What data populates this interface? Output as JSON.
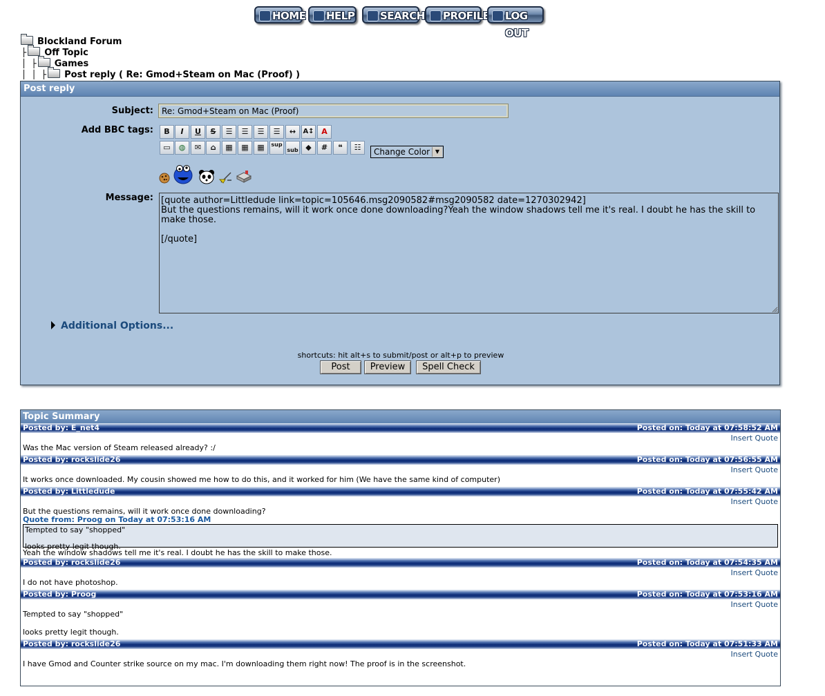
{
  "nav": {
    "home": "HOME",
    "help": "HELP",
    "search": "SEARCH",
    "profile": "PROFILE",
    "logout": "LOG OUT"
  },
  "breadcrumb": {
    "level0": "Blockland Forum",
    "level1": "Off Topic",
    "level2": "Games",
    "level3": "Post reply ( Re: Gmod+Steam on Mac (Proof) )"
  },
  "reply": {
    "header": "Post reply",
    "subject_label": "Subject:",
    "subject_value": "Re: Gmod+Steam on Mac (Proof)",
    "bbc_label": "Add BBC tags:",
    "color_select": "Change Color",
    "message_label": "Message:",
    "message_value": "[quote author=Littledude link=topic=105646.msg2090582#msg2090582 date=1270302942]\nBut the questions remains, will it work once done downloading?Yeah the window shadows tell me it's real. I doubt he has the skill to make those.\n\n[/quote]",
    "additional_options": "Additional Options...",
    "shortcuts": "shortcuts: hit alt+s to submit/post or alt+p to preview",
    "post_button": "Post",
    "preview_button": "Preview",
    "spellcheck_button": "Spell Check",
    "toolbar_row1": [
      "B",
      "I",
      "U",
      "S",
      "≡",
      "≡",
      "≡",
      "≡",
      "↔",
      "A↕",
      "A"
    ],
    "toolbar_row2_text": {
      "sup": "sup",
      "sub": "sub"
    }
  },
  "summary": {
    "header": "Topic Summary",
    "insert_quote": "Insert Quote",
    "posts": [
      {
        "by": "Posted by: E_net4",
        "on": "Posted on: Today at 07:58:52 AM",
        "text": "Was the Mac version of Steam released already? :/"
      },
      {
        "by": "Posted by: rockslide26",
        "on": "Posted on: Today at 07:56:55 AM",
        "text": "It works once downloaded. My cousin showed me how to do this, and it worked for him (We have the same kind of computer)"
      },
      {
        "by": "Posted by: Littledude",
        "on": "Posted on: Today at 07:55:42 AM",
        "text": "But the questions remains, will it work once done downloading?",
        "quote_header": "Quote from: Proog on Today at 07:53:16 AM",
        "quote_text": "Tempted to say \"shopped\"\n\nlooks pretty legit though.",
        "after_text": "Yeah the window shadows tell me it's real. I doubt he has the skill to make those."
      },
      {
        "by": "Posted by: rockslide26",
        "on": "Posted on: Today at 07:54:35 AM",
        "text": "I do not have photoshop."
      },
      {
        "by": "Posted by: Proog",
        "on": "Posted on: Today at 07:53:16 AM",
        "text": "Tempted to say \"shopped\"\n\nlooks pretty legit though."
      },
      {
        "by": "Posted by: rockslide26",
        "on": "Posted on: Today at 07:51:33 AM",
        "text": "I have Gmod and Counter strike source on my mac. I'm downloading them right now! The proof is in the screenshot."
      }
    ]
  }
}
